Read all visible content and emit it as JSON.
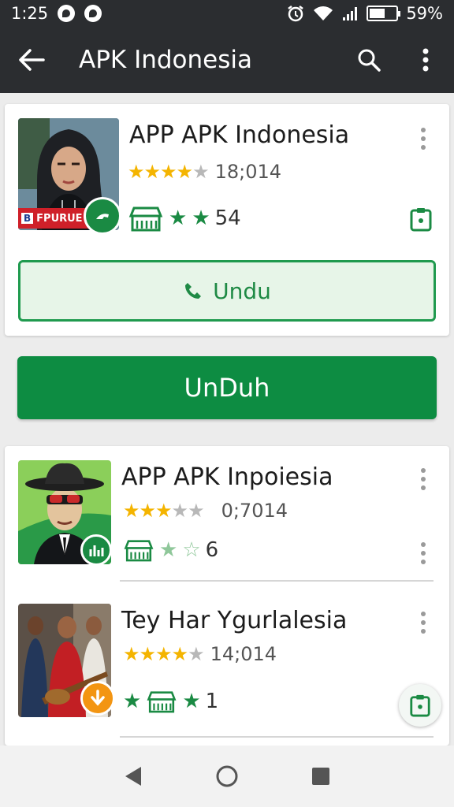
{
  "status_bar": {
    "time": "1:25",
    "battery": "59%",
    "battery_level": 0.59
  },
  "toolbar": {
    "title": "APK Indonesia"
  },
  "featured": {
    "title": "APP APK Indonesia",
    "stars": 4,
    "rating_count": "18;014",
    "stat": "54",
    "thumb_banner_text": "FPURUE",
    "download_button": "Undu"
  },
  "primary_button": {
    "label": "UnDuh"
  },
  "list": [
    {
      "title": "APP APK Inpoiesia",
      "stars": 3,
      "rating_count": "0;7014",
      "stat": "6"
    },
    {
      "title": "Tey Har Ygurlalesia",
      "stars": 4,
      "rating_count": "14;014",
      "stat": "1"
    }
  ],
  "colors": {
    "toolbar": "#2b2d30",
    "accent_green": "#0d8c42",
    "star_yellow": "#f4b400",
    "badge_orange": "#f39512"
  }
}
